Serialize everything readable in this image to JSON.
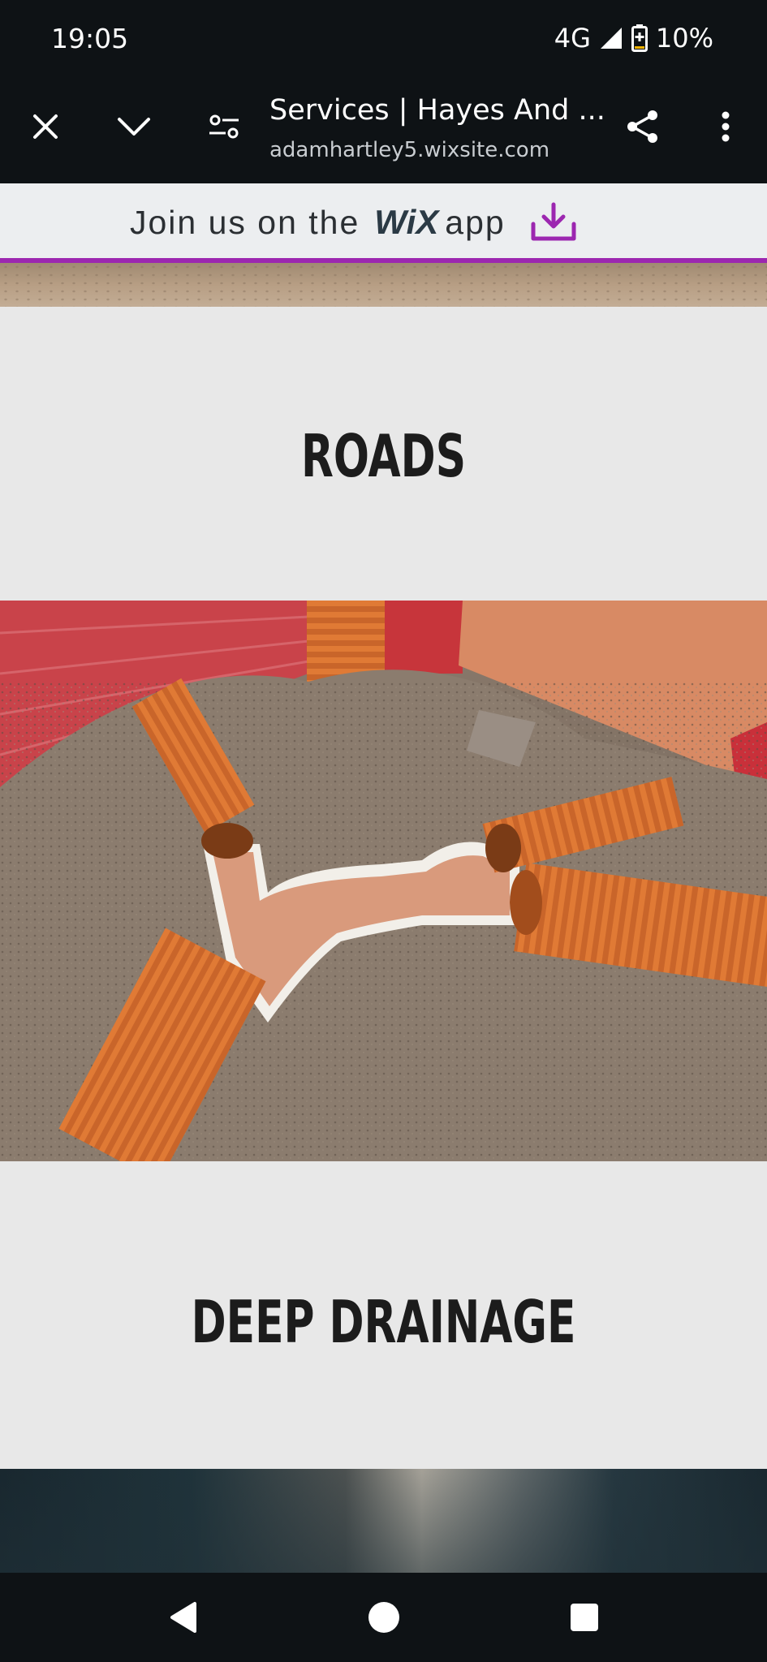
{
  "status_bar": {
    "time": "19:05",
    "network": "4G",
    "battery": "10%",
    "icons": [
      "signal-icon",
      "battery-icon"
    ]
  },
  "browser": {
    "page_title": "Services | Hayes And ...",
    "url": "adamhartley5.wixsite.com",
    "icons": [
      "close-icon",
      "chevron-down-icon",
      "page-settings-icon",
      "share-icon",
      "more-vert-icon"
    ]
  },
  "wix_banner": {
    "prefix": "Join us on the",
    "logo": "WiX",
    "suffix": "app",
    "accent_color": "#9c27b0",
    "icon": "download-icon"
  },
  "sections": [
    {
      "heading": "ROADS"
    },
    {
      "heading": "DEEP DRAINAGE"
    }
  ],
  "photos": [
    {
      "name": "drainage-pipes-photo"
    },
    {
      "name": "street-photo"
    }
  ],
  "nav_bar": {
    "icons": [
      "back-icon",
      "home-icon",
      "recents-icon"
    ]
  }
}
